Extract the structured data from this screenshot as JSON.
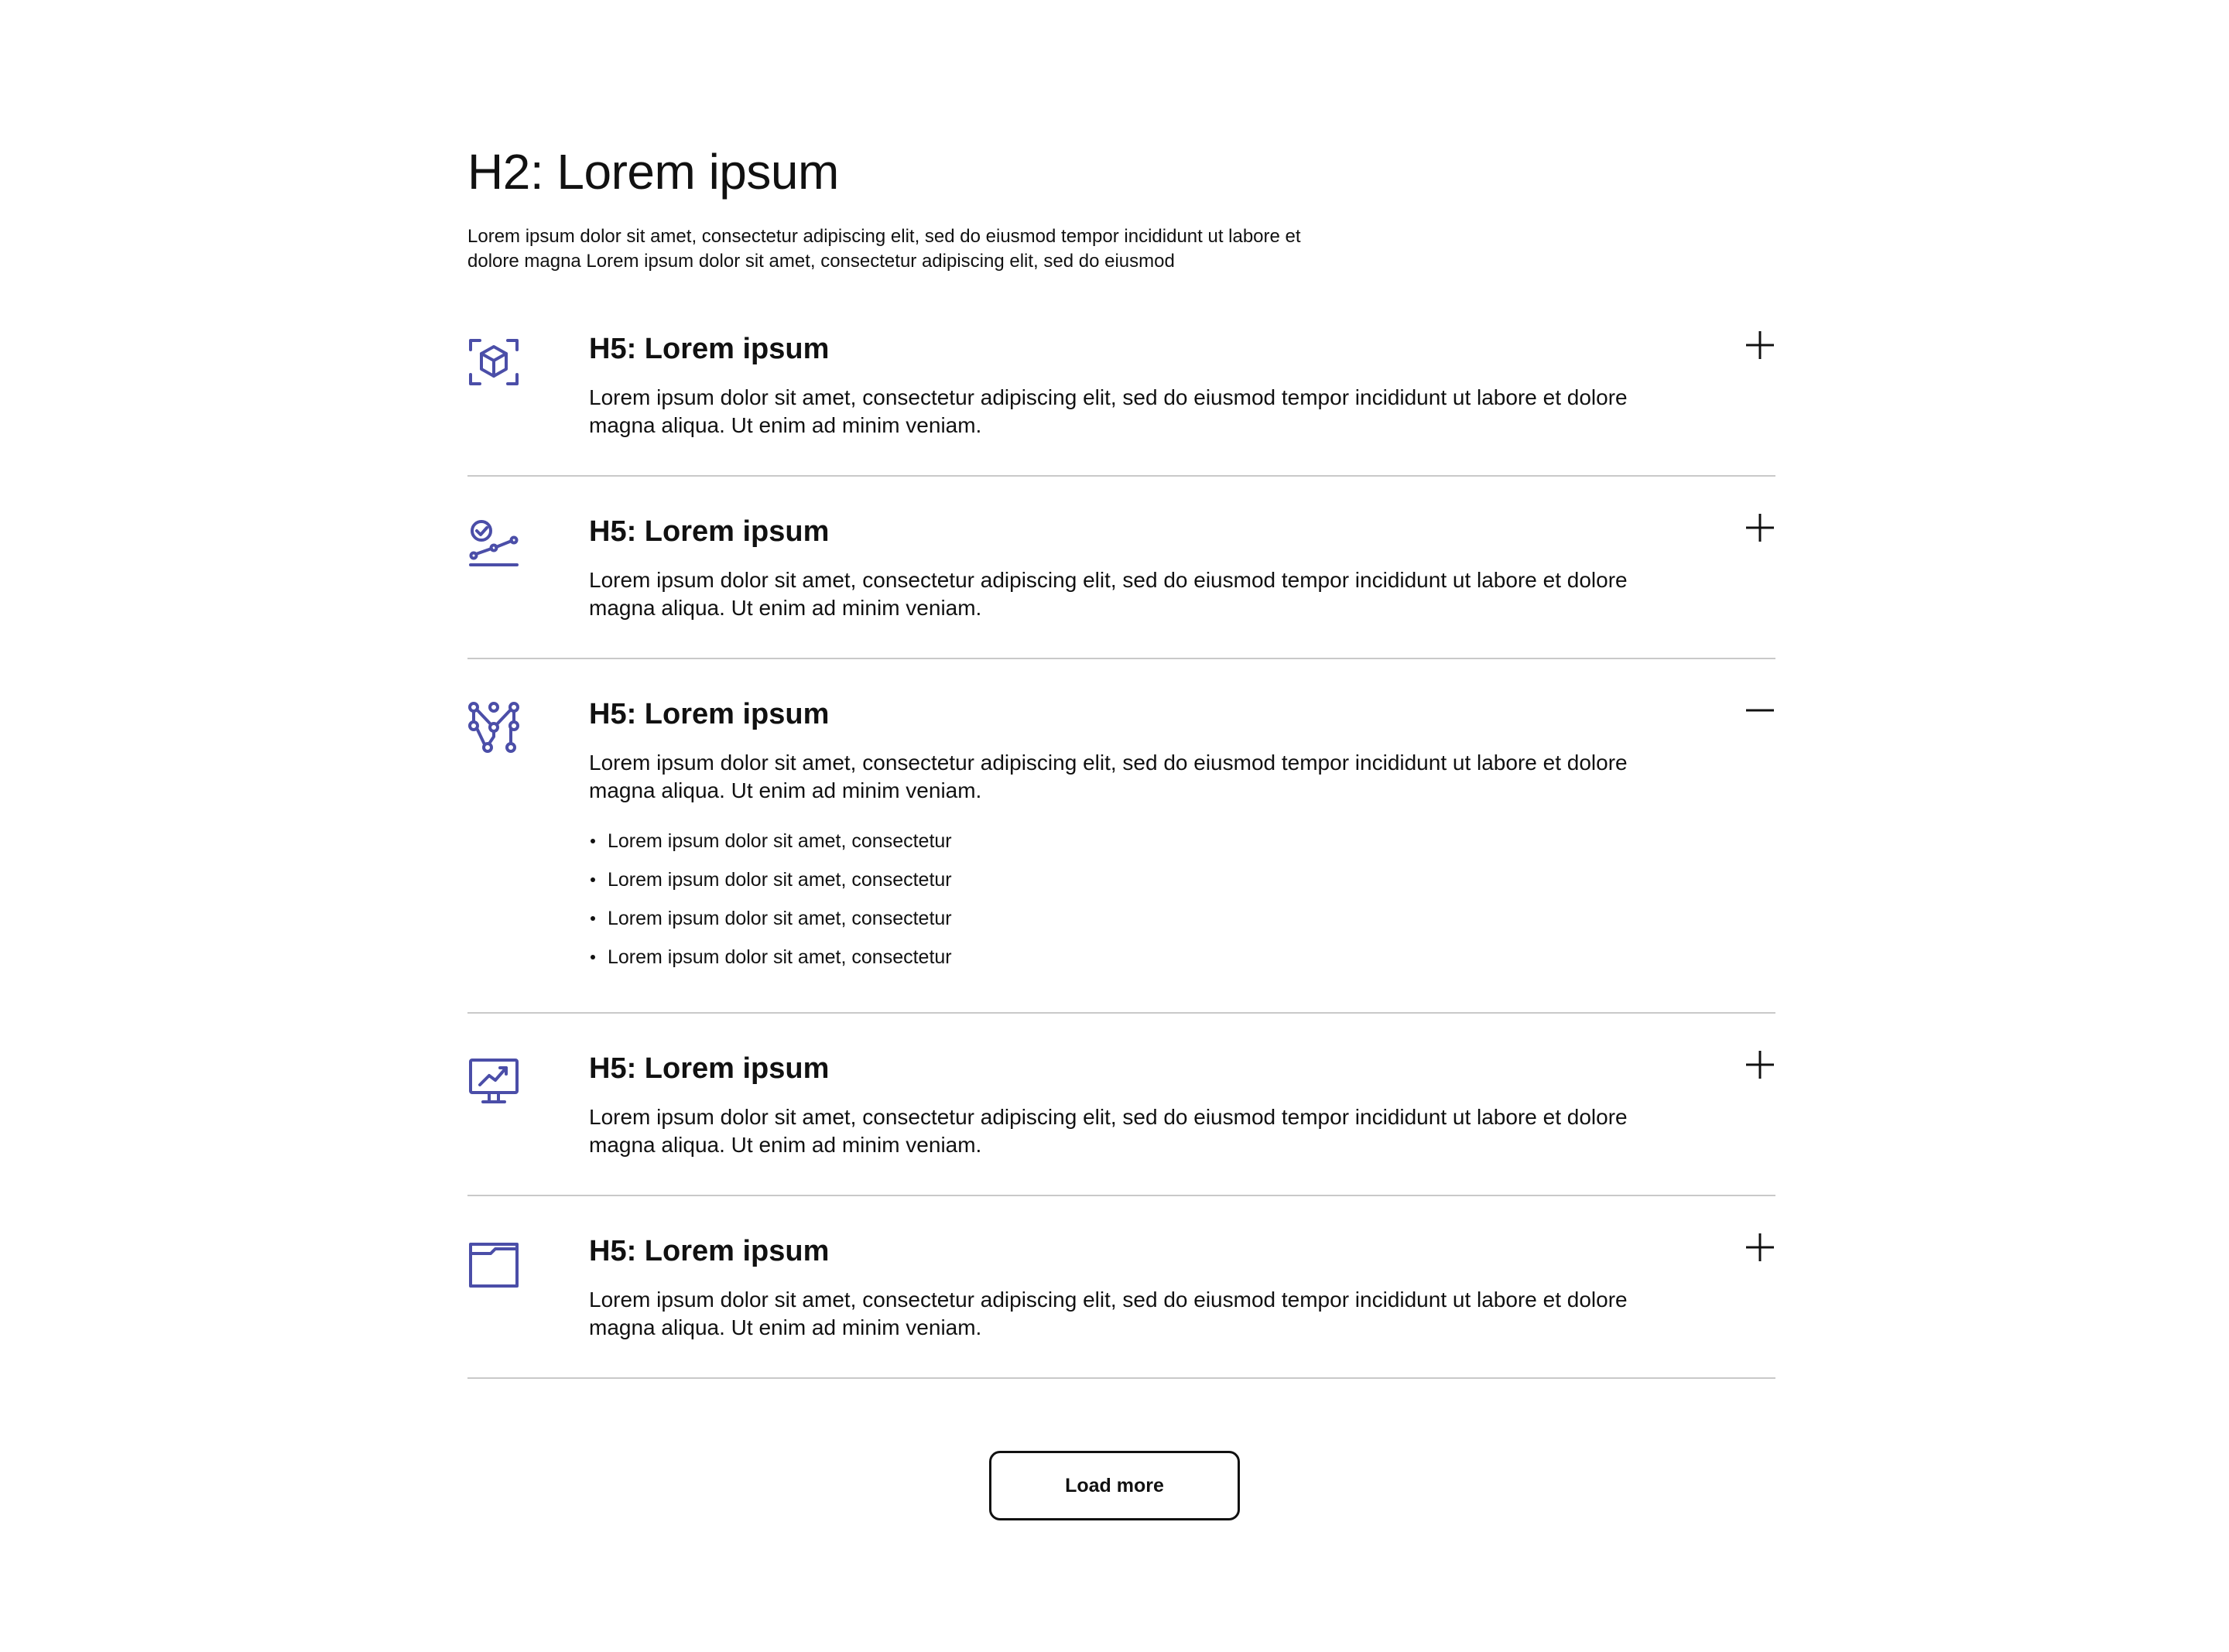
{
  "colors": {
    "icon": "#4b4ea8",
    "divider": "#c9c9c9",
    "text": "#111111"
  },
  "header": {
    "title": "H2: Lorem ipsum",
    "intro": "Lorem ipsum dolor sit amet, consectetur adipiscing elit, sed do eiusmod tempor incididunt ut labore et dolore magna Lorem ipsum dolor sit amet, consectetur adipiscing elit, sed do eiusmod"
  },
  "accordion": {
    "items": [
      {
        "icon": "cube-scan-icon",
        "title": "H5: Lorem ipsum",
        "text": "Lorem ipsum dolor sit amet, consectetur adipiscing elit, sed do eiusmod tempor incididunt ut labore et dolore magna aliqua. Ut enim ad minim veniam.",
        "expanded": false
      },
      {
        "icon": "goal-chart-icon",
        "title": "H5: Lorem ipsum",
        "text": "Lorem ipsum dolor sit amet, consectetur adipiscing elit, sed do eiusmod tempor incididunt ut labore et dolore magna aliqua. Ut enim ad minim veniam.",
        "expanded": false
      },
      {
        "icon": "network-nodes-icon",
        "title": "H5: Lorem ipsum",
        "text": "Lorem ipsum dolor sit amet, consectetur adipiscing elit, sed do eiusmod tempor incididunt ut labore et dolore magna aliqua. Ut enim ad minim veniam.",
        "expanded": true,
        "bullets": [
          "Lorem ipsum dolor sit amet, consectetur",
          "Lorem ipsum dolor sit amet, consectetur",
          "Lorem ipsum dolor sit amet, consectetur",
          "Lorem ipsum dolor sit amet, consectetur"
        ]
      },
      {
        "icon": "monitor-chart-icon",
        "title": "H5: Lorem ipsum",
        "text": "Lorem ipsum dolor sit amet, consectetur adipiscing elit, sed do eiusmod tempor incididunt ut labore et dolore magna aliqua. Ut enim ad minim veniam.",
        "expanded": false
      },
      {
        "icon": "folder-icon",
        "title": "H5: Lorem ipsum",
        "text": "Lorem ipsum dolor sit amet, consectetur adipiscing elit, sed do eiusmod tempor incididunt ut labore et dolore magna aliqua. Ut enim ad minim veniam.",
        "expanded": false
      }
    ]
  },
  "footer": {
    "load_more_label": "Load more"
  }
}
